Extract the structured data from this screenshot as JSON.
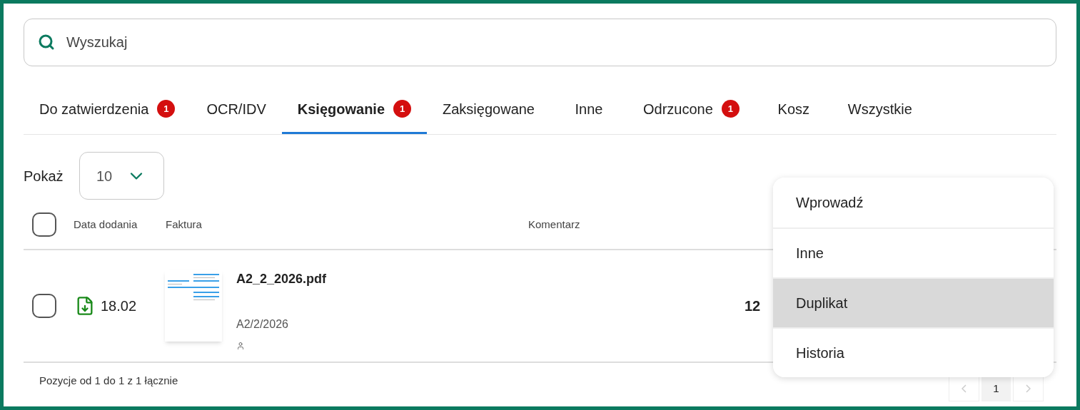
{
  "search": {
    "placeholder": "Wyszukaj"
  },
  "tabs": [
    {
      "label": "Do zatwierdzenia",
      "badge": "1",
      "selected": false
    },
    {
      "label": "OCR/IDV",
      "selected": false
    },
    {
      "label": "Księgowanie",
      "badge": "1",
      "selected": true
    },
    {
      "label": "Zaksięgowane",
      "selected": false
    },
    {
      "label": "Inne",
      "selected": false
    },
    {
      "label": "Odrzucone",
      "badge": "1",
      "selected": false
    },
    {
      "label": "Kosz",
      "selected": false
    },
    {
      "label": "Wszystkie",
      "selected": false
    }
  ],
  "page_size": {
    "label": "Pokaż",
    "value": "10"
  },
  "table": {
    "select_all": {
      "checked": false
    },
    "columns": [
      "Data dodania",
      "Faktura",
      "Komentarz"
    ],
    "rows": [
      {
        "checked": false,
        "date": "18.02",
        "file": "A2_2_2026.pdf",
        "number": "A2/2/2026",
        "amount": "12"
      }
    ]
  },
  "footer": "Pozycje od 1 do 1 z 1 łącznie",
  "pagination": {
    "pages": [
      {
        "label": "1",
        "selected": true
      }
    ]
  },
  "menu": [
    {
      "label": "Wprowadź",
      "selected": false
    },
    {
      "label": "Inne",
      "selected": false
    },
    {
      "label": "Duplikat",
      "selected": true
    },
    {
      "label": "Historia",
      "selected": false
    }
  ]
}
